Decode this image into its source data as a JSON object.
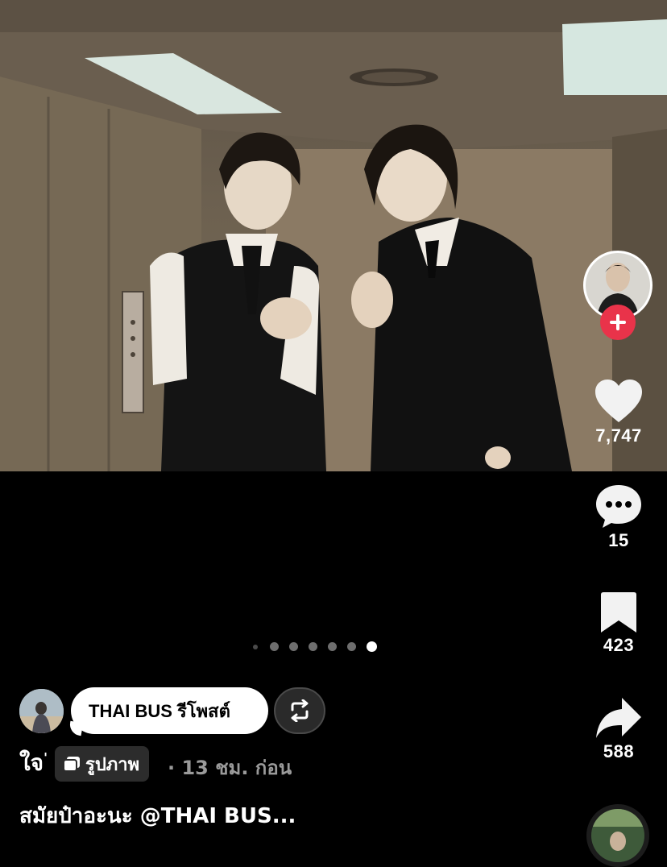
{
  "post": {
    "image_count": 7,
    "active_index": 7
  },
  "rail": {
    "likes": "7,747",
    "comments": "15",
    "saves": "423",
    "shares": "588"
  },
  "repost": {
    "label": "THAI BUS รีโพสต์"
  },
  "author": {
    "username": "ใจ",
    "username_mark": "'",
    "post_type": "รูปภาพ",
    "time": "· 13 ชม. ก่อน"
  },
  "caption": "สมัยป๋าอะนะ @THAI BUS...",
  "colors": {
    "background": "#000000",
    "follow": "#e9334a",
    "text_muted": "#9a9a9a"
  },
  "icons": [
    "heart-icon",
    "comment-icon",
    "bookmark-icon",
    "share-icon",
    "repost-icon",
    "plus-icon",
    "photo-icon"
  ]
}
